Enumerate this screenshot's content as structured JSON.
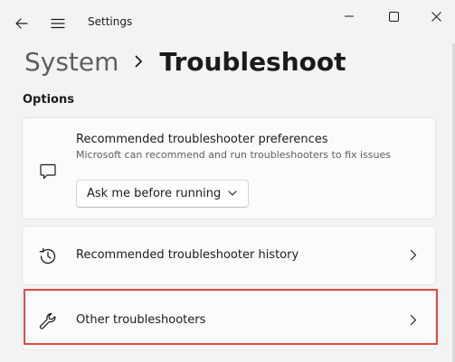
{
  "window": {
    "app_title": "Settings"
  },
  "icons": {
    "back": "back-arrow-icon",
    "menu": "hamburger-icon",
    "minimize": "minimize-icon",
    "maximize": "maximize-icon",
    "close": "close-icon"
  },
  "breadcrumb": {
    "parent": "System",
    "current": "Troubleshoot"
  },
  "options": {
    "section_label": "Options",
    "preferences": {
      "title": "Recommended troubleshooter preferences",
      "description": "Microsoft can recommend and run troubleshooters to fix issues",
      "dropdown_value": "Ask me before running",
      "icon": "feedback-chat-icon"
    },
    "history": {
      "title": "Recommended troubleshooter history",
      "icon": "history-icon"
    },
    "other": {
      "title": "Other troubleshooters",
      "icon": "wrench-icon"
    }
  },
  "colors": {
    "highlight": "#e04a4a",
    "background": "#f3f3f3",
    "card": "#fbfbfb"
  }
}
